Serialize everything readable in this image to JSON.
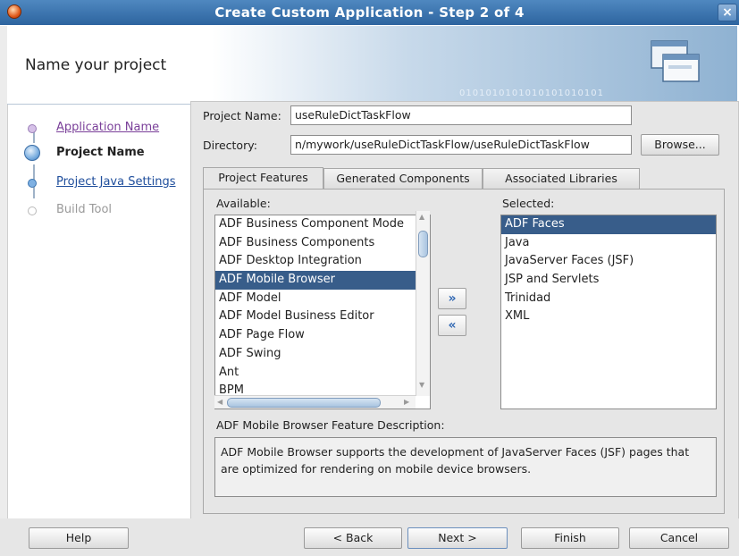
{
  "window": {
    "title": "Create Custom Application - Step 2 of 4",
    "close_glyph": "×"
  },
  "banner": {
    "heading": "Name your project",
    "binary_text": "0101010101010101010101"
  },
  "steps": [
    {
      "label": "Application Name",
      "state": "visited"
    },
    {
      "label": "Project Name",
      "state": "current"
    },
    {
      "label": "Project Java Settings",
      "state": "link"
    },
    {
      "label": "Build Tool",
      "state": "disabled"
    }
  ],
  "form": {
    "project_name_label": "Project Name:",
    "project_name_value": "useRuleDictTaskFlow",
    "directory_label": "Directory:",
    "directory_value": "n/mywork/useRuleDictTaskFlow/useRuleDictTaskFlow",
    "browse_label": "Browse..."
  },
  "tabs": [
    {
      "label": "Project Features",
      "active": true
    },
    {
      "label": "Generated Components",
      "active": false
    },
    {
      "label": "Associated Libraries",
      "active": false
    }
  ],
  "available": {
    "label": "Available:",
    "items": [
      "ADF Business Component Mode",
      "ADF Business Components",
      "ADF Desktop Integration",
      "ADF Mobile Browser",
      "ADF Model",
      "ADF Model Business Editor",
      "ADF Page Flow",
      "ADF Swing",
      "Ant",
      "BPM"
    ],
    "selected_index": 3
  },
  "selected": {
    "label": "Selected:",
    "items": [
      "ADF Faces",
      "Java",
      "JavaServer Faces (JSF)",
      "JSP and Servlets",
      "Trinidad",
      "XML"
    ],
    "selected_index": 0
  },
  "move": {
    "add_glyph": "»",
    "remove_glyph": "«"
  },
  "description": {
    "label": "ADF Mobile Browser Feature Description:",
    "text": "ADF Mobile Browser supports the development of JavaServer Faces (JSF) pages that are optimized for rendering on mobile device browsers."
  },
  "buttons": {
    "help": "Help",
    "back": "< Back",
    "next": "Next >",
    "finish": "Finish",
    "cancel": "Cancel"
  },
  "colors": {
    "title_bar": "#2d649f",
    "selection": "#385d8a",
    "visited_link": "#7a3f99",
    "link": "#1f4e9c"
  }
}
